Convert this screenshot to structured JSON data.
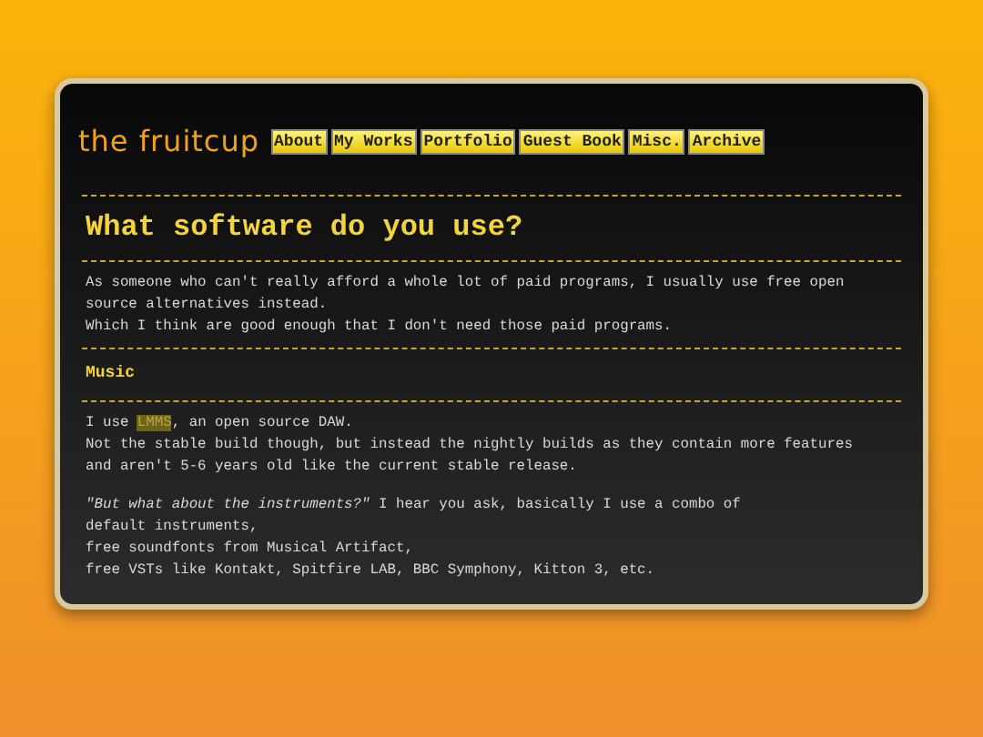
{
  "logo": "the fruitcup",
  "nav": [
    {
      "label": "About"
    },
    {
      "label": "My Works"
    },
    {
      "label": "Portfolio"
    },
    {
      "label": "Guest Book"
    },
    {
      "label": "Misc."
    },
    {
      "label": "Archive"
    }
  ],
  "title": "What software do you use?",
  "intro": [
    "As someone who can't really afford a whole lot of paid programs, I usually use free open source alternatives instead.",
    "Which I think are good enough that I don't need those paid programs."
  ],
  "section": "Music",
  "daw": {
    "before": "I use ",
    "link": "LMMS",
    "after": ", an open source DAW."
  },
  "daw_lines": [
    "Not the stable build though, but instead the nightly builds as they contain more features",
    "and aren't 5-6 years old like the current stable release."
  ],
  "instruments": [
    "*\"But what about the instruments?\"* I hear you ask, basically I use a combo of",
    "default instruments,",
    "free soundfonts from Musical Artifact,",
    "free VSTs like Kontakt, Spitfire LAB, BBC Symphony, Kitton 3, etc."
  ]
}
